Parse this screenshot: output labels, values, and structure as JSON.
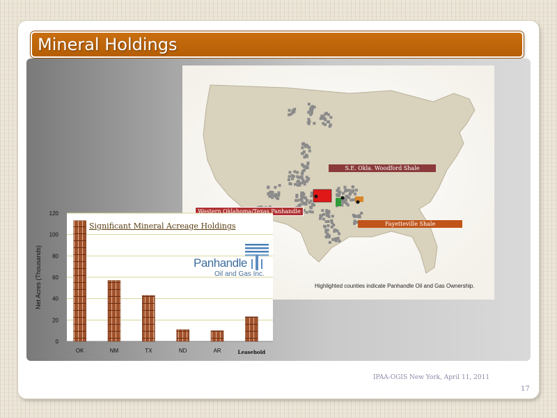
{
  "slide": {
    "title": "Mineral Holdings",
    "footer": "IPAA-OGIS New York, April 11, 2011",
    "page_number": "17"
  },
  "map": {
    "labels": {
      "woodford": "S.E. Okla. Woodford Shale",
      "western": "Western Oklahoma/Texas Panhandle",
      "fayetteville": "Fayetteville Shale"
    },
    "caption": "Highlighted counties indicate Panhandle Oil and Gas Ownership.",
    "colors": {
      "land": "#d9d2bd",
      "owned_counties": "#8a8a8a",
      "western_highlight": "#e01818",
      "woodford_highlight": "#2e9a3a",
      "fayetteville_highlight": "#d8862a"
    }
  },
  "logo": {
    "name": "Panhandle",
    "subtitle": "Oil and Gas Inc."
  },
  "chart_data": {
    "type": "bar",
    "title": "Significant Mineral Acreage Holdings",
    "ylabel": "Net Acres (Thousands)",
    "xlabel": "",
    "categories": [
      "OK",
      "NM",
      "TX",
      "ND",
      "AR",
      "Leasehold"
    ],
    "values": [
      113,
      57,
      43,
      11,
      10,
      23
    ],
    "ylim": [
      0,
      120
    ],
    "yticks": [
      "0",
      "20",
      "40",
      "60",
      "80",
      "100",
      "120"
    ],
    "grid": true,
    "bar_color": "#a0522d"
  }
}
